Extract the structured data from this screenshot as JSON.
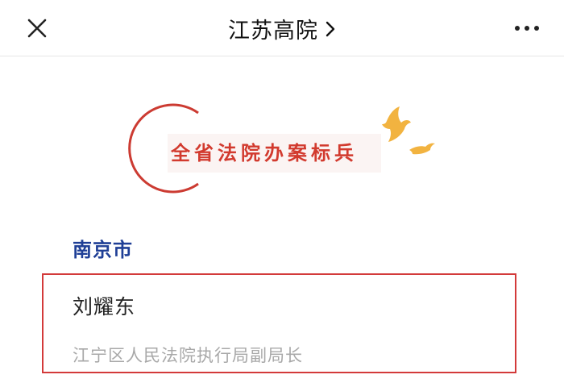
{
  "nav": {
    "title": "江苏高院",
    "close_icon": "close-icon",
    "chevron_icon": "chevron-right-icon",
    "more_icon": "more-icon"
  },
  "banner": {
    "text": "全省法院办案标兵",
    "accent_color": "#d23a2e",
    "bird_color": "#f2b340"
  },
  "section": {
    "city": "南京市",
    "city_color": "#1f3f96"
  },
  "person": {
    "name": "刘耀东",
    "title": "江宁区人民法院执行局副局长",
    "highlight_color": "#d33a3a"
  }
}
